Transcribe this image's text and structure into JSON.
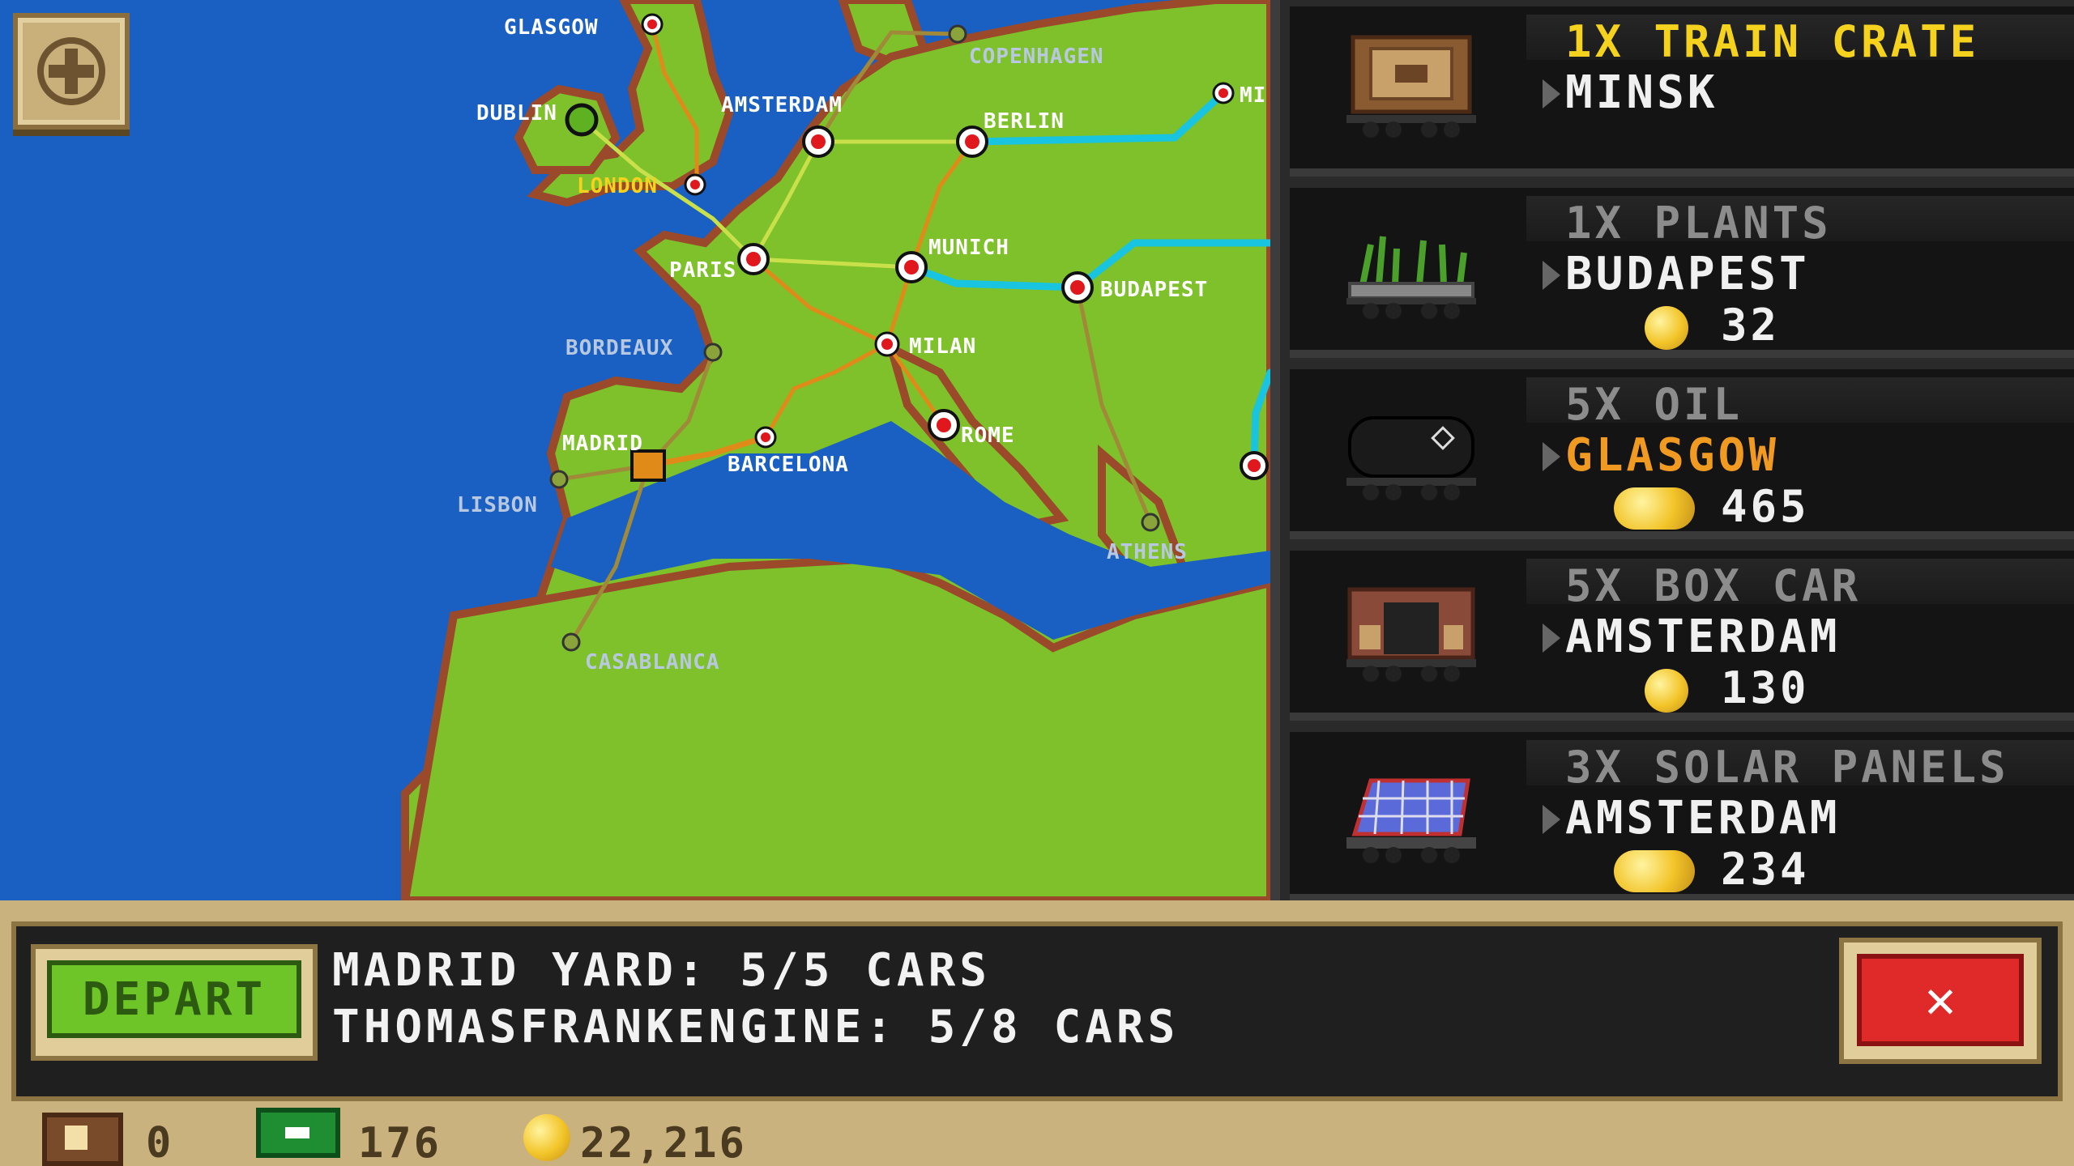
{
  "map": {
    "zoom_button_icon": "plus-icon",
    "colors": {
      "sea": "#1a5fc2",
      "land": "#7ec12a",
      "route_active": "#18c4e0",
      "route_owned": "#e08a1a",
      "station_red": "#e0181e"
    },
    "cities": [
      {
        "id": "glasgow",
        "label": "GLASGOW"
      },
      {
        "id": "dublin",
        "label": "DUBLIN"
      },
      {
        "id": "london",
        "label": "LONDON"
      },
      {
        "id": "amsterdam",
        "label": "AMSTERDAM"
      },
      {
        "id": "copenhagen",
        "label": "COPENHAGEN"
      },
      {
        "id": "berlin",
        "label": "BERLIN"
      },
      {
        "id": "minsk",
        "label": "MI"
      },
      {
        "id": "paris",
        "label": "PARIS"
      },
      {
        "id": "munich",
        "label": "MUNICH"
      },
      {
        "id": "budapest",
        "label": "BUDAPEST"
      },
      {
        "id": "bordeaux",
        "label": "BORDEAUX"
      },
      {
        "id": "milan",
        "label": "MILAN"
      },
      {
        "id": "madrid",
        "label": "MADRID"
      },
      {
        "id": "barcelona",
        "label": "BARCELONA"
      },
      {
        "id": "rome",
        "label": "ROME"
      },
      {
        "id": "lisbon",
        "label": "LISBON"
      },
      {
        "id": "athens",
        "label": "ATHENS"
      },
      {
        "id": "casablanca",
        "label": "CASABLANCA"
      }
    ]
  },
  "cargo": [
    {
      "title": "1X TRAIN CRATE",
      "destination": "MINSK",
      "reward": "",
      "title_highlight": true,
      "dest_highlight": false,
      "icon": "train-crate-icon"
    },
    {
      "title": "1X PLANTS",
      "destination": "BUDAPEST",
      "reward": "32",
      "title_highlight": false,
      "dest_highlight": false,
      "icon": "plants-car-icon"
    },
    {
      "title": "5X OIL",
      "destination": "GLASGOW",
      "reward": "465",
      "title_highlight": false,
      "dest_highlight": true,
      "icon": "oil-tank-car-icon"
    },
    {
      "title": "5X BOX CAR",
      "destination": "AMSTERDAM",
      "reward": "130",
      "title_highlight": false,
      "dest_highlight": false,
      "icon": "box-car-icon"
    },
    {
      "title": "3X SOLAR PANELS",
      "destination": "AMSTERDAM",
      "reward": "234",
      "title_highlight": false,
      "dest_highlight": false,
      "icon": "solar-panel-car-icon"
    }
  ],
  "bottom": {
    "depart_label": "DEPART",
    "yard_line": "MADRID YARD: 5/5 CARS",
    "engine_line": "THOMASFRANKENGINE: 5/8 CARS",
    "close_label": "✕",
    "crates": "0",
    "cash": "176",
    "coins": "22,216"
  }
}
